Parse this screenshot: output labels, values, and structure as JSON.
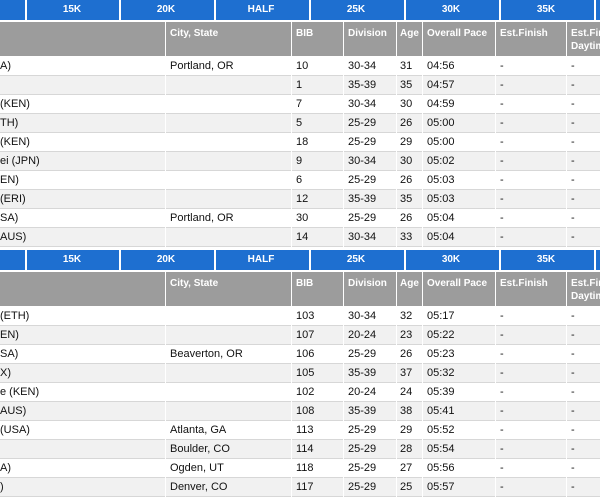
{
  "tabs": [
    "15K",
    "20K",
    "HALF",
    "25K",
    "30K",
    "35K"
  ],
  "headers": {
    "city": "City, State",
    "bib": "BIB",
    "division": "Division",
    "age": "Age",
    "pace": "Overall Pace",
    "estfinish": "Est.Finish",
    "estday_line1": "Est.Finish",
    "estday_line2": "Daytime"
  },
  "table1": [
    {
      "name": "A)",
      "city": "Portland, OR",
      "bib": "10",
      "division": "30-34",
      "age": "31",
      "pace": "04:56",
      "estfinish": "-",
      "estday": "-"
    },
    {
      "name": "",
      "city": "",
      "bib": "1",
      "division": "35-39",
      "age": "35",
      "pace": "04:57",
      "estfinish": "-",
      "estday": "-"
    },
    {
      "name": "(KEN)",
      "city": "",
      "bib": "7",
      "division": "30-34",
      "age": "30",
      "pace": "04:59",
      "estfinish": "-",
      "estday": "-"
    },
    {
      "name": "TH)",
      "city": "",
      "bib": "5",
      "division": "25-29",
      "age": "26",
      "pace": "05:00",
      "estfinish": "-",
      "estday": "-"
    },
    {
      "name": "(KEN)",
      "city": "",
      "bib": "18",
      "division": "25-29",
      "age": "29",
      "pace": "05:00",
      "estfinish": "-",
      "estday": "-"
    },
    {
      "name": "ei (JPN)",
      "city": "",
      "bib": "9",
      "division": "30-34",
      "age": "30",
      "pace": "05:02",
      "estfinish": "-",
      "estday": "-"
    },
    {
      "name": "EN)",
      "city": "",
      "bib": "6",
      "division": "25-29",
      "age": "26",
      "pace": "05:03",
      "estfinish": "-",
      "estday": "-"
    },
    {
      "name": "(ERI)",
      "city": "",
      "bib": "12",
      "division": "35-39",
      "age": "35",
      "pace": "05:03",
      "estfinish": "-",
      "estday": "-"
    },
    {
      "name": "SA)",
      "city": "Portland, OR",
      "bib": "30",
      "division": "25-29",
      "age": "26",
      "pace": "05:04",
      "estfinish": "-",
      "estday": "-"
    },
    {
      "name": "AUS)",
      "city": "",
      "bib": "14",
      "division": "30-34",
      "age": "33",
      "pace": "05:04",
      "estfinish": "-",
      "estday": "-"
    }
  ],
  "table2": [
    {
      "name": "(ETH)",
      "city": "",
      "bib": "103",
      "division": "30-34",
      "age": "32",
      "pace": "05:17",
      "estfinish": "-",
      "estday": "-"
    },
    {
      "name": "EN)",
      "city": "",
      "bib": "107",
      "division": "20-24",
      "age": "23",
      "pace": "05:22",
      "estfinish": "-",
      "estday": "-"
    },
    {
      "name": "SA)",
      "city": "Beaverton, OR",
      "bib": "106",
      "division": "25-29",
      "age": "26",
      "pace": "05:23",
      "estfinish": "-",
      "estday": "-"
    },
    {
      "name": "X)",
      "city": "",
      "bib": "105",
      "division": "35-39",
      "age": "37",
      "pace": "05:32",
      "estfinish": "-",
      "estday": "-"
    },
    {
      "name": "e (KEN)",
      "city": "",
      "bib": "102",
      "division": "20-24",
      "age": "24",
      "pace": "05:39",
      "estfinish": "-",
      "estday": "-"
    },
    {
      "name": "AUS)",
      "city": "",
      "bib": "108",
      "division": "35-39",
      "age": "38",
      "pace": "05:41",
      "estfinish": "-",
      "estday": "-"
    },
    {
      "name": "(USA)",
      "city": "Atlanta, GA",
      "bib": "113",
      "division": "25-29",
      "age": "29",
      "pace": "05:52",
      "estfinish": "-",
      "estday": "-"
    },
    {
      "name": "",
      "city": "Boulder, CO",
      "bib": "114",
      "division": "25-29",
      "age": "28",
      "pace": "05:54",
      "estfinish": "-",
      "estday": "-"
    },
    {
      "name": "A)",
      "city": "Ogden, UT",
      "bib": "118",
      "division": "25-29",
      "age": "27",
      "pace": "05:56",
      "estfinish": "-",
      "estday": "-"
    },
    {
      "name": ")",
      "city": "Denver, CO",
      "bib": "117",
      "division": "25-29",
      "age": "25",
      "pace": "05:57",
      "estfinish": "-",
      "estday": "-"
    }
  ],
  "colors": {
    "tabbar": "#1e6fd0",
    "header": "#9c9c9c",
    "row_alt": "#f1f1f1"
  }
}
